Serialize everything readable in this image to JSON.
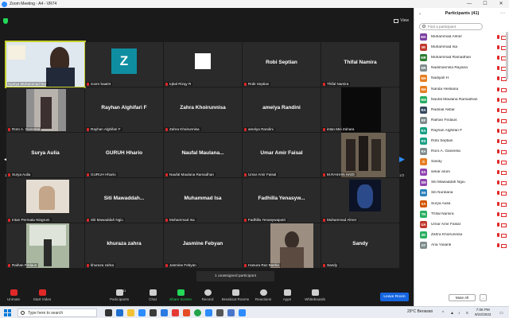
{
  "window": {
    "title": "Zoom Meeting - A4 - VR74",
    "minimize": "—",
    "maximize": "☐",
    "close": "✕"
  },
  "view_label": "View",
  "pager": {
    "prev": "◀",
    "next": "▶",
    "page_left": "1/2",
    "page_right": "1/2"
  },
  "tiles": [
    {
      "label": "Syarya Muhammad Nur",
      "big": "",
      "kind": "video"
    },
    {
      "label": "zoom baa04",
      "big": "",
      "kind": "avatar",
      "avatar": "Z"
    },
    {
      "label": "Iqbal Rizqy R",
      "big": "",
      "kind": "white"
    },
    {
      "label": "Robi Septian",
      "big": "Robi Septian",
      "kind": "name"
    },
    {
      "label": "Thifal Namira",
      "big": "Thifal Namira",
      "kind": "name"
    },
    {
      "label": "Roro A. Ganeesa",
      "big": "",
      "kind": "video"
    },
    {
      "label": "Rayhan Alghifari F",
      "big": "Rayhan Alghifari F",
      "kind": "name"
    },
    {
      "label": "Zahra Khoirunnisa",
      "big": "Zahra Khoirunnisa",
      "kind": "name"
    },
    {
      "label": "amelya Randini",
      "big": "amelya Randini",
      "kind": "name"
    },
    {
      "label": "intan Mei Zahara",
      "big": "",
      "kind": "video"
    },
    {
      "label": "Surya Aulia",
      "big": "Surya Aulia",
      "kind": "name"
    },
    {
      "label": "GURUH Hhario",
      "big": "GURUH Hhario",
      "kind": "name"
    },
    {
      "label": "Naufal Maulana Ramadhan",
      "big": "Naufal Maulana...",
      "kind": "name"
    },
    {
      "label": "Umar Amir Faisal",
      "big": "Umar Amir Faisal",
      "kind": "name"
    },
    {
      "label": "M.RAIHAN HADI",
      "big": "",
      "kind": "video"
    },
    {
      "label": "Intan Permata Ningrum",
      "big": "",
      "kind": "video"
    },
    {
      "label": "Siti Mawaddah Ngiu",
      "big": "Siti Mawaddah...",
      "kind": "name"
    },
    {
      "label": "Muhammad Isa",
      "big": "Muhammad Isa",
      "kind": "name"
    },
    {
      "label": "Fadhilla Yenasywaputri",
      "big": "Fadhilla Yenasyw...",
      "kind": "name"
    },
    {
      "label": "Muhammad Almer",
      "big": "",
      "kind": "video"
    },
    {
      "label": "Raihan Firdaus",
      "big": "",
      "kind": "video"
    },
    {
      "label": "khuraza zahra",
      "big": "khuraza zahra",
      "kind": "name"
    },
    {
      "label": "Jasmine Febyan",
      "big": "Jasmine Febyan",
      "kind": "name"
    },
    {
      "label": "Hanura Raz Basha",
      "big": "",
      "kind": "video"
    },
    {
      "label": "Sandy",
      "big": "Sandy",
      "kind": "name"
    }
  ],
  "unassigned": "1 unassigned participant",
  "toolbar": {
    "unmute": "Unmute",
    "start_video": "Start Video",
    "participants": "Participants",
    "participants_count": "41",
    "chat": "Chat",
    "share_screen": "Share Screen",
    "record": "Record",
    "breakout": "Breakout Rooms",
    "reactions": "Reactions",
    "apps": "Apps",
    "whiteboards": "Whiteboards",
    "leave": "Leave Room"
  },
  "panel": {
    "title": "Participants (41)",
    "search_placeholder": "Find a participant",
    "mute_all": "Mute All",
    "more": "...",
    "participants": [
      {
        "initials": "MA",
        "name": "Muhammad Almer",
        "color": "#7b3fa0"
      },
      {
        "initials": "MI",
        "name": "Muhammad Isa",
        "color": "#c0392b"
      },
      {
        "initials": "MR",
        "name": "Muhammad Ramadhan",
        "color": "#2e7d32"
      },
      {
        "initials": "NR",
        "name": "Nadimannisa Rayana",
        "color": "#7f8c8d"
      },
      {
        "initials": "NH",
        "name": "Nadiyah H",
        "color": "#e67e22"
      },
      {
        "initials": "NH",
        "name": "Nanda Hesliana",
        "color": "#e67e22"
      },
      {
        "initials": "NM",
        "name": "Naufal Maulana Ramadhan",
        "color": "#27ae60"
      },
      {
        "initials": "RA",
        "name": "Radinal Akbar",
        "color": "#34495e"
      },
      {
        "initials": "RF",
        "name": "Raihan Firdaus",
        "color": "#7f8c8d"
      },
      {
        "initials": "RA",
        "name": "Rayhan Alghifari F",
        "color": "#16a085"
      },
      {
        "initials": "RS",
        "name": "Robi Septian",
        "color": "#16a085"
      },
      {
        "initials": "RA",
        "name": "Roro A. Ganeesa",
        "color": "#7f8c8d"
      },
      {
        "initials": "S",
        "name": "Sandy",
        "color": "#e67e22"
      },
      {
        "initials": "SA",
        "name": "sekar arum",
        "color": "#8e44ad"
      },
      {
        "initials": "SM",
        "name": "Siti Mawaddah Ngiu",
        "color": "#8e44ad"
      },
      {
        "initials": "SN",
        "name": "Siti Nurdiana",
        "color": "#2980b9"
      },
      {
        "initials": "SA",
        "name": "Surya Aulia",
        "color": "#d35400"
      },
      {
        "initials": "TN",
        "name": "Thifal Namira",
        "color": "#27ae60"
      },
      {
        "initials": "UA",
        "name": "Umar Amir Faisal",
        "color": "#c0392b"
      },
      {
        "initials": "ZK",
        "name": "Zahra Khoirunnisa",
        "color": "#27ae60"
      },
      {
        "initials": "AY",
        "name": "Ana Yulianti",
        "color": "#7f8c8d"
      }
    ]
  },
  "taskbar": {
    "search_placeholder": "Type here to search",
    "weather": "29°C Berawan",
    "time": "7:06 PM",
    "date": "9/22/2022"
  },
  "icons": {
    "mic_off": "mic-off-icon",
    "video_off": "video-off-icon",
    "search": "search-icon"
  }
}
